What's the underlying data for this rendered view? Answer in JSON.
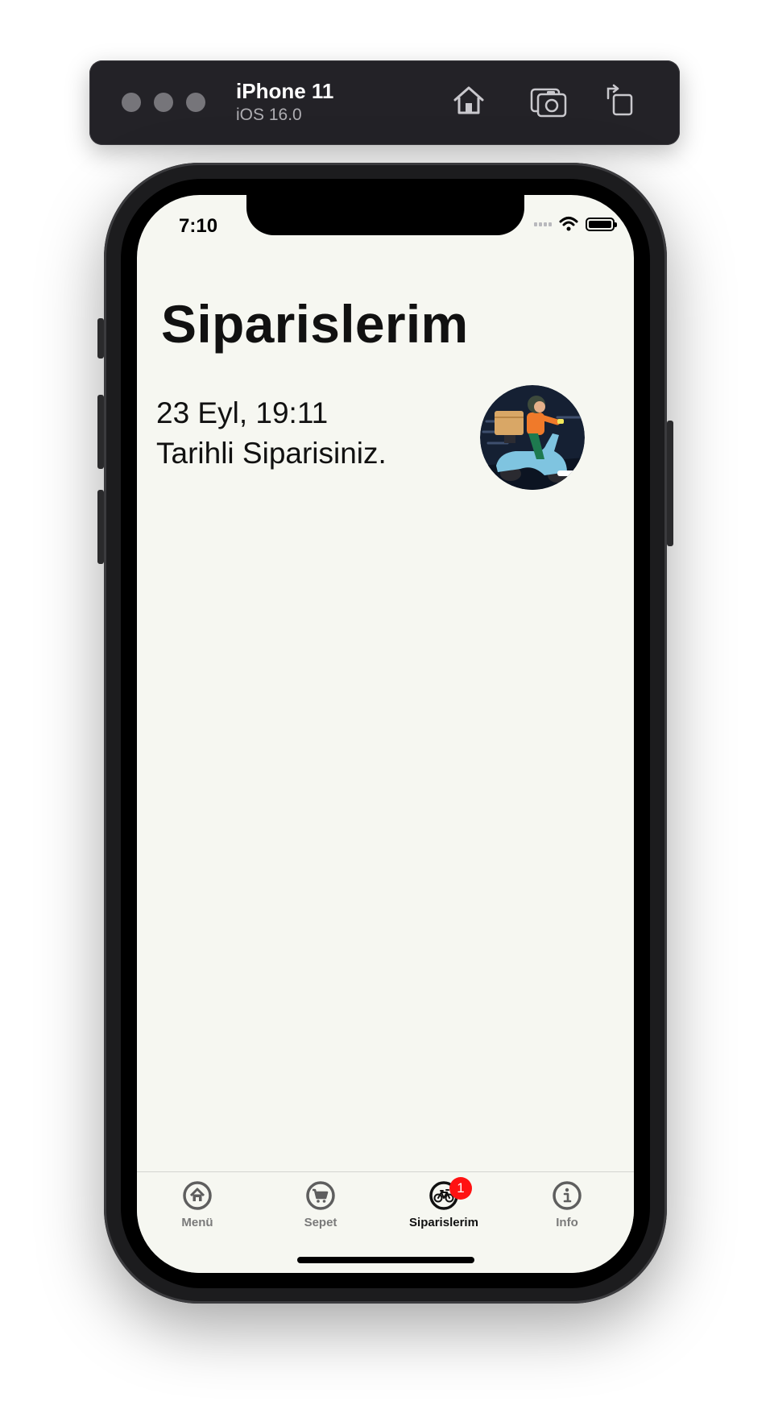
{
  "simulator": {
    "device_name": "iPhone 11",
    "os_version": "iOS 16.0",
    "buttons": [
      "home-icon",
      "screenshot-icon",
      "rotate-icon"
    ]
  },
  "status_bar": {
    "time": "7:10"
  },
  "page": {
    "title": "Siparislerim"
  },
  "orders": [
    {
      "date": "23 Eyl, 19:11",
      "description": "Tarihli Siparisiniz."
    }
  ],
  "tabbar": {
    "tabs": [
      {
        "label": "Menü",
        "icon": "home-icon",
        "active": false
      },
      {
        "label": "Sepet",
        "icon": "cart-icon",
        "active": false
      },
      {
        "label": "Siparislerim",
        "icon": "bicycle-icon",
        "active": true,
        "badge": "1"
      },
      {
        "label": "Info",
        "icon": "info-icon",
        "active": false
      }
    ]
  },
  "colors": {
    "screen_bg": "#f6f7f1",
    "badge": "#ff1212",
    "toolbar_bg": "#232227"
  }
}
